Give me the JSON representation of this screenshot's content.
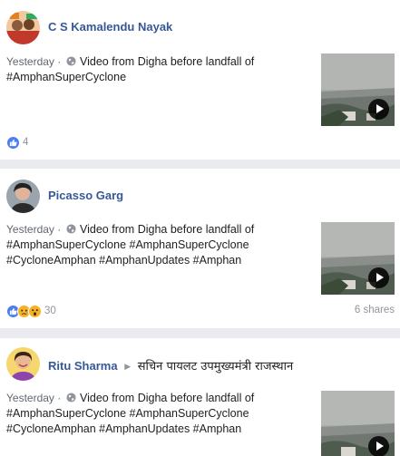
{
  "posts": [
    {
      "author": "C S Kamalendu Nayak",
      "time": "Yesterday",
      "text_lines": [
        "Video from Digha before landfall of",
        "#AmphanSuperCyclone"
      ],
      "reaction_count": "4",
      "reactions": [
        "like-icon"
      ],
      "shares": ""
    },
    {
      "author": "Picasso Garg",
      "time": "Yesterday",
      "text_lines": [
        "Video from Digha before landfall of",
        "#AmphanSuperCyclone #AmphanSuperCyclone",
        "#CycloneAmphan #AmphanUpdates #Amphan"
      ],
      "reaction_count": "30",
      "reactions": [
        "like-icon",
        "sad-icon",
        "wow-icon"
      ],
      "shares": "6 shares"
    },
    {
      "author": "Ritu Sharma",
      "page": "सचिन पायलट उपमुख्यमंत्री राजस्थान",
      "time": "Yesterday",
      "text_lines": [
        "Video from Digha before landfall of",
        "#AmphanSuperCyclone #AmphanSuperCyclone",
        "#CycloneAmphan #AmphanUpdates #Amphan"
      ]
    }
  ],
  "icons": {
    "globe": "globe-icon",
    "play": "play-icon",
    "arrow": "arrow-right-icon"
  },
  "colors": {
    "author": "#365899",
    "like": "#4c7ef3",
    "sad": "#f7b125",
    "meta": "#616770",
    "page_bg": "#e9ebee"
  }
}
